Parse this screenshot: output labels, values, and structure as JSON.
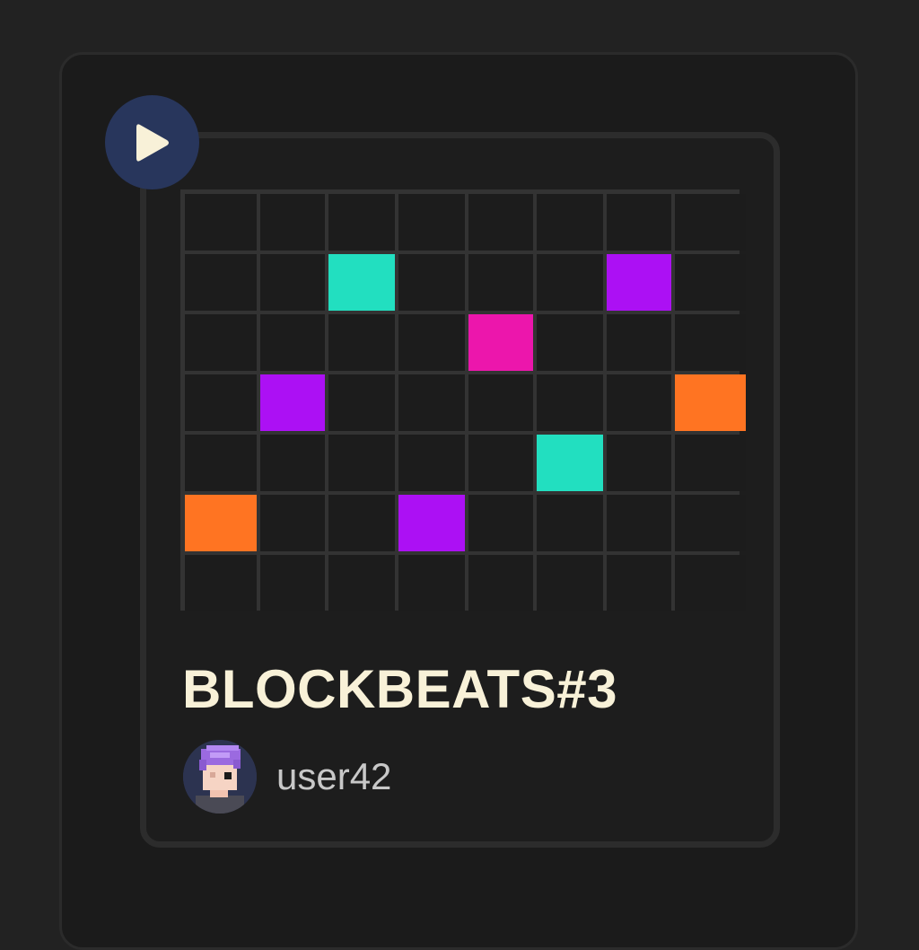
{
  "track": {
    "title": "BLOCKBEATS#3",
    "username": "user42"
  },
  "player": {
    "icon": "play-icon",
    "accent": "#28365c",
    "icon_color": "#f8f1d8"
  },
  "sequencer": {
    "columns": 8,
    "rows": 7,
    "empty_color": "#1c1c1c",
    "line_color": "#333333",
    "active_cells": [
      {
        "row": 1,
        "col": 2,
        "color": "#22dfc0"
      },
      {
        "row": 1,
        "col": 6,
        "color": "#ac10f4"
      },
      {
        "row": 2,
        "col": 4,
        "color": "#ec16ac"
      },
      {
        "row": 3,
        "col": 1,
        "color": "#ac10f4"
      },
      {
        "row": 3,
        "col": 7,
        "color": "#ff7422"
      },
      {
        "row": 4,
        "col": 5,
        "color": "#22dfc0"
      },
      {
        "row": 5,
        "col": 0,
        "color": "#ff7422"
      },
      {
        "row": 5,
        "col": 3,
        "color": "#ac10f4"
      }
    ]
  },
  "avatar": {
    "icon": "pixel-avatar-icon"
  }
}
